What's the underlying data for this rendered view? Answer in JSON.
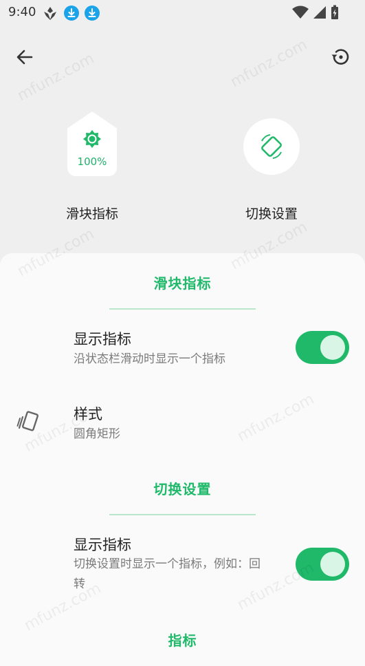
{
  "status_bar": {
    "time": "9:40"
  },
  "toolbar": {
    "back_icon": "arrow-left-icon",
    "restore_icon": "restore-icon"
  },
  "preview": {
    "slider": {
      "percent": "100%",
      "label": "滑块指标",
      "icon": "brightness-icon"
    },
    "switch": {
      "label": "切换设置",
      "icon": "rotate-icon"
    }
  },
  "sheet": {
    "slider_section": {
      "title": "滑块指标",
      "show_indicator": {
        "title": "显示指标",
        "subtitle": "沿状态栏滑动时显示一个指标",
        "enabled": true
      },
      "style": {
        "title": "样式",
        "subtitle": "圆角矩形"
      }
    },
    "switch_section": {
      "title": "切换设置",
      "show_indicator": {
        "title": "显示指标",
        "subtitle": "切换设置时显示一个指标，例如：回转",
        "enabled": true
      }
    },
    "indicator_section": {
      "title": "指标"
    }
  },
  "colors": {
    "accent": "#20b96a",
    "background": "#efefef",
    "sheet": "#fafafa"
  },
  "watermark": "mfunz.com"
}
